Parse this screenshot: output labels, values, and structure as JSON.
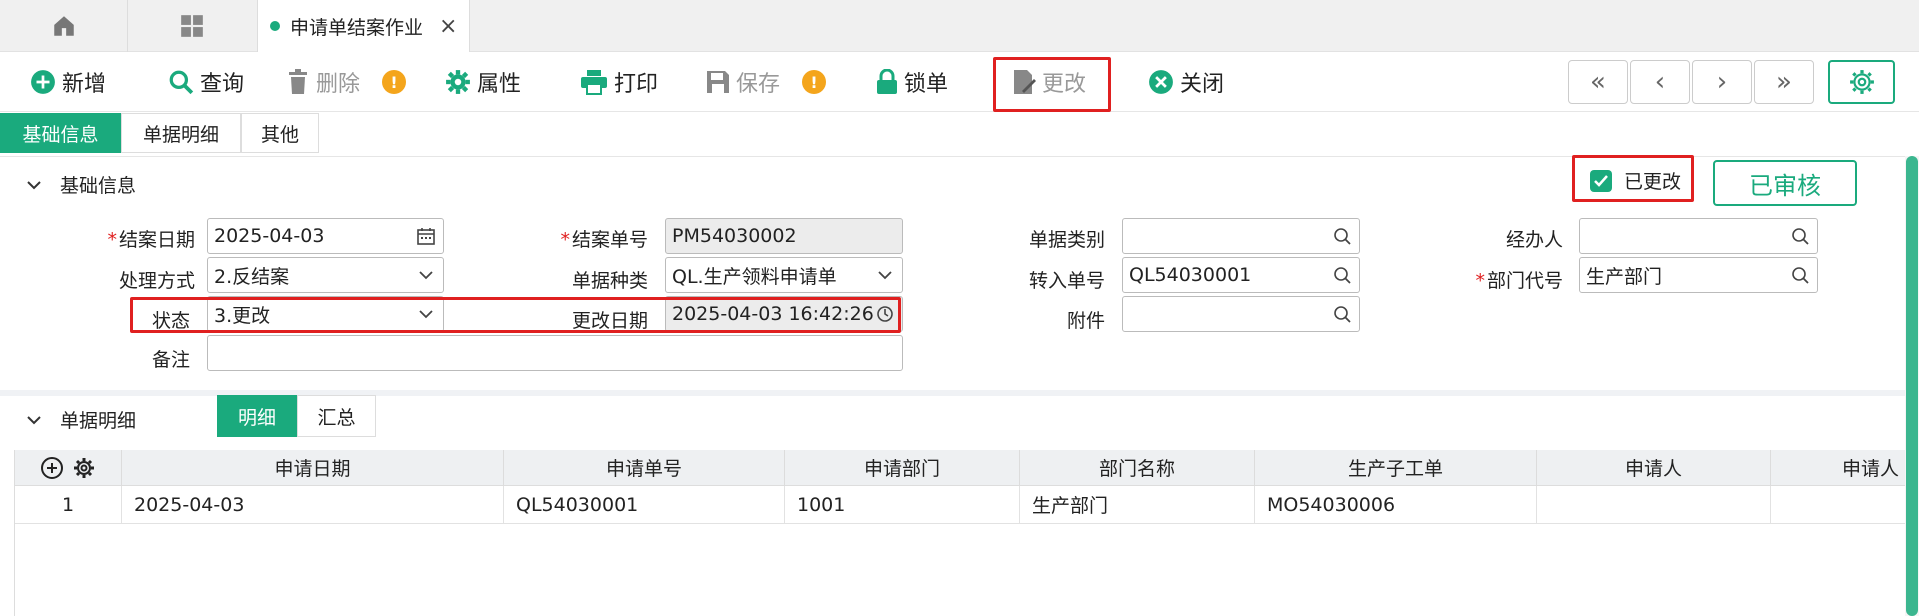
{
  "tabs": {
    "active_title": "申请单结案作业",
    "close_glyph": "×"
  },
  "toolbar": {
    "add": "新增",
    "query": "查询",
    "delete": "删除",
    "properties": "属性",
    "print": "打印",
    "save": "保存",
    "lock": "锁单",
    "modify": "更改",
    "close": "关闭",
    "warn_glyph": "!"
  },
  "nav": {
    "first": "«",
    "prev": "‹",
    "next": "›",
    "last": "»"
  },
  "subtabs": [
    "基础信息",
    "单据明细",
    "其他"
  ],
  "basic": {
    "section_title": "基础信息",
    "modified_label": "已更改",
    "approved_label": "已审核",
    "close_date_label": "结案日期",
    "close_date_value": "2025-04-03",
    "close_no_label": "结案单号",
    "close_no_value": "PM54030002",
    "doc_category_label": "单据类别",
    "doc_category_value": "",
    "handler_label": "经办人",
    "handler_value": "",
    "process_label": "处理方式",
    "process_value": "2.反结案",
    "doc_type_label": "单据种类",
    "doc_type_value": "QL.生产领料申请单",
    "transfer_no_label": "转入单号",
    "transfer_no_value": "QL54030001",
    "dept_code_label": "部门代号",
    "dept_code_value": "生产部门",
    "status_label": "状态",
    "status_value": "3.更改",
    "modify_date_label": "更改日期",
    "modify_date_value": "2025-04-03 16:42:26",
    "attachment_label": "附件",
    "attachment_value": "",
    "remark_label": "备注",
    "remark_value": ""
  },
  "detail": {
    "section_title": "单据明细",
    "tabs": [
      "明细",
      "汇总"
    ],
    "columns": [
      "申请日期",
      "申请单号",
      "申请部门",
      "部门名称",
      "生产子工单",
      "申请人",
      "申请人"
    ],
    "rows": [
      {
        "index": "1",
        "cells": [
          "2025-04-03",
          "QL54030001",
          "1001",
          "生产部门",
          "MO54030006",
          "",
          ""
        ]
      }
    ]
  },
  "colors": {
    "accent": "#1aaa7d",
    "highlight": "#e02020",
    "warning": "#f4a51c"
  }
}
